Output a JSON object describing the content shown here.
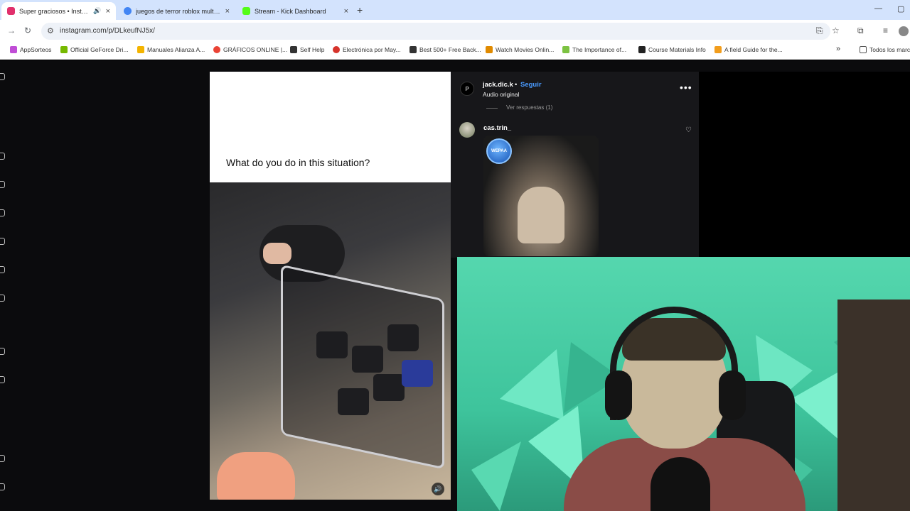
{
  "browser": {
    "tabs": [
      {
        "title": "Super graciosos • Instagram",
        "active": true,
        "audio": true,
        "favicon_color": "#e1306c"
      },
      {
        "title": "juegos de terror roblox multijug",
        "active": false,
        "favicon_color": "#4285f4"
      },
      {
        "title": "Stream - Kick Dashboard",
        "active": false,
        "favicon_color": "#53fc18"
      }
    ],
    "new_tab": "+",
    "url": "instagram.com/p/DLkeufNJ5x/",
    "bookmarks": [
      {
        "label": "AppSorteos",
        "color": "#c04dd6"
      },
      {
        "label": "Official GeForce Dri...",
        "color": "#76b900"
      },
      {
        "label": "Manuales Alianza A...",
        "color": "#f4b400"
      },
      {
        "label": "GRÁFICOS ONLINE |...",
        "color": "#ea4335"
      },
      {
        "label": "Self Help",
        "color": "#333333"
      },
      {
        "label": "Electrónica por May...",
        "color": "#d6332b"
      },
      {
        "label": "Best 500+ Free Back...",
        "color": "#333333"
      },
      {
        "label": "Watch Movies Onlin...",
        "color": "#e08a00"
      },
      {
        "label": "The Importance of...",
        "color": "#7cc242"
      },
      {
        "label": "Course Materials Info",
        "color": "#222222"
      },
      {
        "label": "A field Guide for the...",
        "color": "#f29d1c"
      }
    ],
    "bookmarks_overflow": "»",
    "all_bookmarks": "Todos los marc"
  },
  "post": {
    "caption": "What do you do in this situation?",
    "header": {
      "username": "jack.dic.k",
      "separator": "•",
      "follow": "Seguir",
      "audio": "Audio original",
      "more": "•••"
    },
    "replies_link": "Ver respuestas (1)",
    "comment": {
      "username": "cas.trin_",
      "gif_badge": "WEPAA"
    }
  },
  "colors": {
    "accent": "#4a9bff",
    "webcam_bg": "#4ccfa6"
  }
}
